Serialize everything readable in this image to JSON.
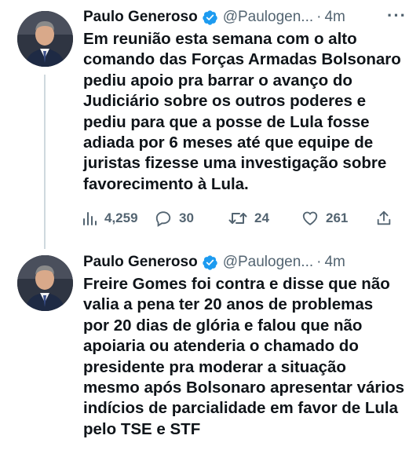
{
  "tweets": [
    {
      "author": {
        "name": "Paulo Generoso",
        "handle": "@Paulogen...",
        "time": "4m"
      },
      "separator": "·",
      "more": "···",
      "lines": [
        "Em reunião esta semana com o alto",
        "comando das Forças Armadas Bolsonaro",
        "pediu apoio pra barrar o avanço do",
        "Judiciário sobre os outros poderes e",
        "pediu para que a posse de Lula fosse",
        "adiada por 6 meses até que equipe de",
        "juristas fizesse uma investigação sobre",
        "favorecimento à Lula."
      ],
      "stats": {
        "views": "4,259",
        "replies": "30",
        "retweets": "24",
        "likes": "261"
      }
    },
    {
      "author": {
        "name": "Paulo Generoso",
        "handle": "@Paulogen...",
        "time": "4m"
      },
      "separator": "·",
      "lines": [
        "Freire Gomes foi contra e disse que não",
        "valia a pena ter 20 anos de problemas",
        "por 20 dias de glória e falou que não",
        "apoiaria ou atenderia o chamado do",
        "presidente pra moderar a situação",
        "mesmo após Bolsonaro apresentar vários",
        "indícios de parcialidade em favor de Lula",
        "pelo TSE e STF"
      ]
    }
  ],
  "colors": {
    "text": "#0f1419",
    "secondary": "#536471",
    "verified": "#1d9bf0",
    "thread_line": "#cfd9de"
  },
  "icons": [
    "verified-badge-icon",
    "more-icon",
    "views-icon",
    "reply-icon",
    "retweet-icon",
    "like-icon",
    "share-icon"
  ]
}
